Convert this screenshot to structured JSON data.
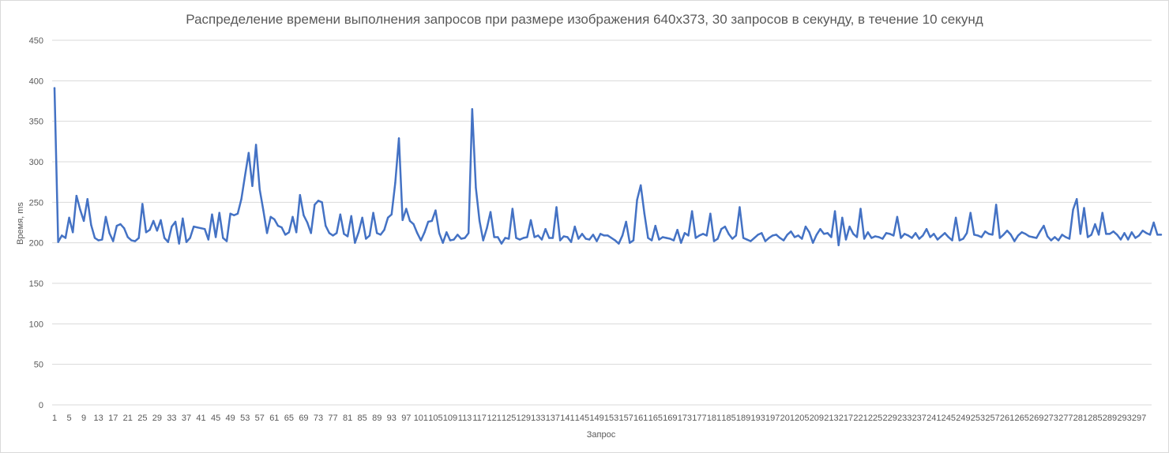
{
  "chart_data": {
    "type": "line",
    "title": "Распределение времени выполнения запросов при размере изображения 640x373, 30 запросов в секунду, в течение 10 секунд",
    "xlabel": "Запрос",
    "ylabel": "Время, ms",
    "ylim": [
      0,
      450
    ],
    "yticks": [
      0,
      50,
      100,
      150,
      200,
      250,
      300,
      350,
      400,
      450
    ],
    "xlim": [
      1,
      300
    ],
    "xtick_labels": [
      "1",
      "5",
      "9",
      "13",
      "17",
      "21",
      "25",
      "29",
      "33",
      "37",
      "41",
      "45",
      "49",
      "53",
      "57",
      "61",
      "65",
      "69",
      "73",
      "77",
      "81",
      "85",
      "89",
      "93",
      "97",
      "101",
      "105",
      "109",
      "113",
      "117",
      "121",
      "125",
      "129",
      "133",
      "137",
      "141",
      "145",
      "149",
      "153",
      "157",
      "161",
      "165",
      "169",
      "173",
      "177",
      "181",
      "185",
      "189",
      "193",
      "197",
      "201",
      "205",
      "209",
      "213",
      "217",
      "221",
      "225",
      "229",
      "233",
      "237",
      "241",
      "245",
      "249",
      "253",
      "257",
      "261",
      "265",
      "269",
      "273",
      "277",
      "281",
      "285",
      "289",
      "293",
      "297"
    ],
    "grid": true,
    "legend": "none",
    "colors": {
      "series": "#4472c4",
      "grid": "#d9d9d9",
      "text": "#595959"
    },
    "series": [
      {
        "x_start": 1,
        "values": [
          391,
          201,
          209,
          206,
          231,
          213,
          258,
          241,
          227,
          254,
          222,
          206,
          203,
          204,
          232,
          212,
          202,
          221,
          223,
          218,
          207,
          203,
          202,
          206,
          248,
          213,
          216,
          227,
          215,
          228,
          206,
          201,
          220,
          226,
          199,
          230,
          201,
          206,
          220,
          219,
          218,
          217,
          204,
          235,
          207,
          237,
          206,
          202,
          236,
          234,
          236,
          254,
          283,
          311,
          270,
          321,
          266,
          240,
          212,
          232,
          229,
          221,
          219,
          210,
          213,
          232,
          213,
          259,
          234,
          225,
          212,
          247,
          252,
          250,
          221,
          212,
          209,
          212,
          235,
          211,
          208,
          233,
          200,
          213,
          231,
          205,
          209,
          237,
          212,
          210,
          216,
          231,
          235,
          274,
          329,
          228,
          242,
          227,
          223,
          212,
          203,
          213,
          226,
          227,
          240,
          212,
          200,
          213,
          203,
          204,
          210,
          205,
          206,
          212,
          365,
          268,
          227,
          203,
          218,
          238,
          207,
          207,
          199,
          206,
          205,
          242,
          206,
          204,
          206,
          207,
          228,
          207,
          209,
          204,
          217,
          206,
          206,
          244,
          203,
          208,
          207,
          201,
          220,
          205,
          211,
          205,
          204,
          210,
          202,
          211,
          209,
          209,
          206,
          203,
          199,
          209,
          226,
          200,
          203,
          253,
          271,
          236,
          206,
          203,
          221,
          204,
          207,
          206,
          205,
          203,
          216,
          200,
          212,
          209,
          239,
          206,
          209,
          211,
          209,
          236,
          202,
          205,
          217,
          220,
          211,
          205,
          209,
          244,
          206,
          204,
          202,
          206,
          210,
          212,
          202,
          206,
          209,
          210,
          206,
          203,
          210,
          214,
          207,
          209,
          205,
          220,
          213,
          200,
          210,
          217,
          211,
          212,
          207,
          239,
          197,
          231,
          204,
          220,
          211,
          207,
          242,
          205,
          213,
          206,
          208,
          207,
          205,
          212,
          211,
          209,
          232,
          206,
          211,
          209,
          206,
          212,
          205,
          209,
          217,
          207,
          211,
          204,
          208,
          212,
          207,
          203,
          231,
          203,
          205,
          212,
          237,
          210,
          209,
          207,
          214,
          211,
          210,
          247,
          206,
          210,
          215,
          210,
          202,
          209,
          213,
          211,
          208,
          207,
          206,
          214,
          221,
          208,
          203,
          207,
          203,
          210,
          207,
          205,
          241,
          254,
          211,
          243,
          207,
          210,
          223,
          210,
          237,
          211,
          211,
          214,
          210,
          204,
          212,
          204,
          213,
          206,
          209,
          215,
          212,
          210,
          225,
          210,
          210
        ]
      }
    ]
  }
}
